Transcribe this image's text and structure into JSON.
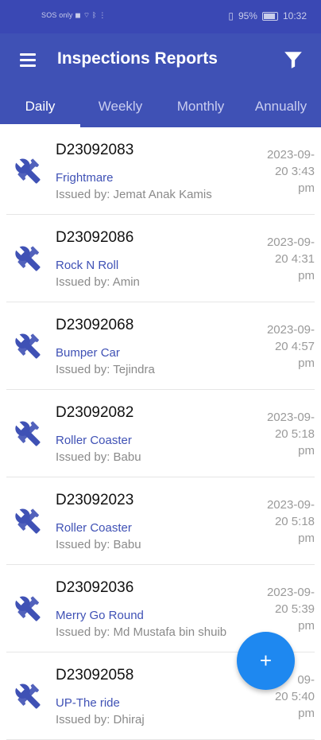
{
  "statusbar": {
    "left_text": "SOS only ◼ ⌔ ᛒ ⋮",
    "battery_text": "95%",
    "time": "10:32"
  },
  "app": {
    "title": "Inspections Reports",
    "menu_icon": "hamburger-icon",
    "filter_icon": "filter-icon"
  },
  "tabs": [
    {
      "label": "Daily"
    },
    {
      "label": "Weekly"
    },
    {
      "label": "Monthly"
    },
    {
      "label": "Annually"
    }
  ],
  "reports": [
    {
      "code": "D23092083",
      "ride": "Frightmare",
      "issued": "Issued by: Jemat Anak Kamis",
      "date1": "2023-09-",
      "date2": "20 3:43",
      "date3": "pm"
    },
    {
      "code": "D23092086",
      "ride": "Rock N Roll",
      "issued": "Issued by: Amin",
      "date1": "2023-09-",
      "date2": "20 4:31",
      "date3": "pm"
    },
    {
      "code": "D23092068",
      "ride": "Bumper Car",
      "issued": "Issued by: Tejindra",
      "date1": "2023-09-",
      "date2": "20 4:57",
      "date3": "pm"
    },
    {
      "code": "D23092082",
      "ride": "Roller Coaster",
      "issued": "Issued by: Babu",
      "date1": "2023-09-",
      "date2": "20 5:18",
      "date3": "pm"
    },
    {
      "code": "D23092023",
      "ride": "Roller Coaster",
      "issued": "Issued by: Babu",
      "date1": "2023-09-",
      "date2": "20 5:18",
      "date3": "pm"
    },
    {
      "code": "D23092036",
      "ride": "Merry Go Round",
      "issued": "Issued by: Md Mustafa bin shuib",
      "date1": "2023-09-",
      "date2": "20 5:39",
      "date3": "pm"
    },
    {
      "code": "D23092058",
      "ride": "UP-The ride",
      "issued": "Issued by: Dhiraj",
      "date1": "09-",
      "date2": "20 5:40",
      "date3": "pm"
    }
  ],
  "fab": {
    "label": "+"
  },
  "colors": {
    "primary": "#3f51b5",
    "accent": "#1e88f0",
    "statusbar": "#3a48b4"
  }
}
